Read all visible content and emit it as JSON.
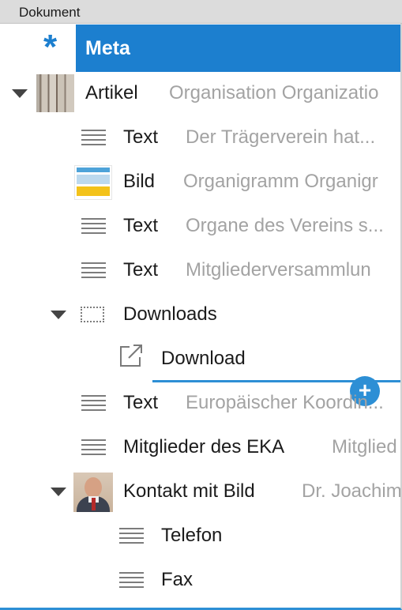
{
  "header": {
    "title": "Dokument"
  },
  "meta": {
    "label": "Meta",
    "icon": "asterisk-icon"
  },
  "tree": [
    {
      "label": "Artikel",
      "preview": "Organisation Organizatio",
      "icon": "artikel-thumbnail"
    },
    {
      "label": "Text",
      "preview": "Der Trägerverein hat...",
      "icon": "text-lines-icon"
    },
    {
      "label": "Bild",
      "preview": "Organigramm Organigr",
      "icon": "bild-thumbnail"
    },
    {
      "label": "Text",
      "preview": "Organe des Vereins s...",
      "icon": "text-lines-icon"
    },
    {
      "label": "Text",
      "preview": "Mitgliederversammlun",
      "icon": "text-lines-icon"
    },
    {
      "label": "Downloads",
      "preview": "",
      "icon": "container-icon"
    },
    {
      "label": "Download",
      "preview": "",
      "icon": "external-link-icon"
    },
    {
      "label": "Text",
      "preview": "Europäischer Koordin...",
      "icon": "text-lines-icon"
    },
    {
      "label": "Mitglieder des EKA",
      "preview": "Mitglied",
      "icon": "text-lines-icon"
    },
    {
      "label": "Kontakt mit Bild",
      "preview": "Dr. Joachim",
      "icon": "contact-photo"
    },
    {
      "label": "Telefon",
      "preview": "",
      "icon": "text-lines-icon"
    },
    {
      "label": "Fax",
      "preview": "",
      "icon": "text-lines-icon"
    }
  ],
  "add_button": {
    "label": "+"
  },
  "colors": {
    "accent": "#1c7fcf",
    "insert_line": "#2d8fd5"
  }
}
